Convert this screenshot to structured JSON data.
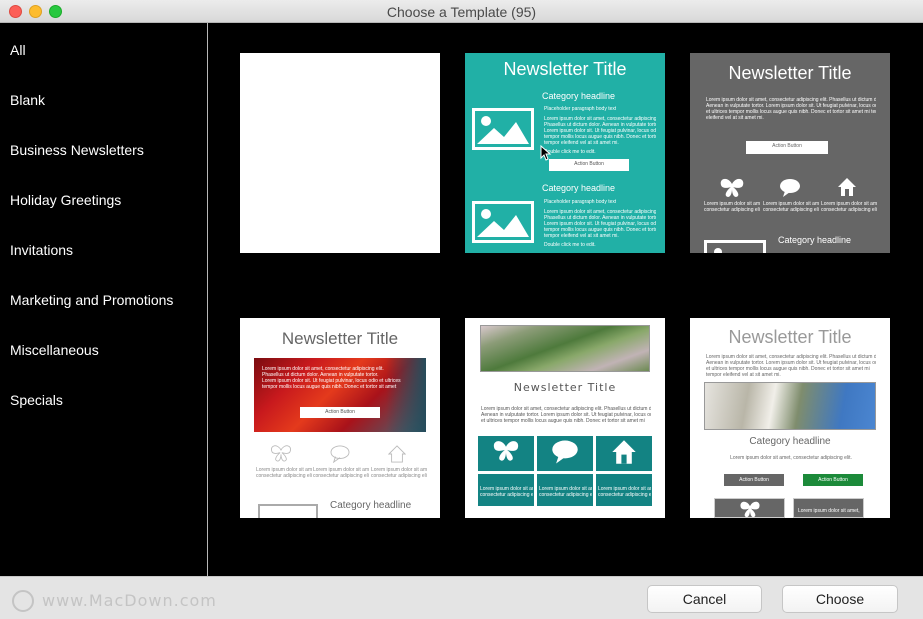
{
  "window": {
    "title": "Choose a Template (95)"
  },
  "sidebar": {
    "categories": [
      {
        "label": "All"
      },
      {
        "label": "Blank"
      },
      {
        "label": "Business Newsletters"
      },
      {
        "label": "Holiday Greetings"
      },
      {
        "label": "Invitations"
      },
      {
        "label": "Marketing and Promotions"
      },
      {
        "label": "Miscellaneous"
      },
      {
        "label": "Specials"
      }
    ]
  },
  "templates": {
    "t2": {
      "title": "Newsletter Title",
      "headline": "Category headline",
      "placeholder": "Placeholder paragraph body text",
      "lorem1": "Lorem ipsum dolor sit amet, consectetur adipiscing elit.",
      "lorem2": "Phasellus ut dictum dolor. Aenean in vulputate tortor.",
      "lorem3": "Lorem ipsum dolor sit. Ut feugiat pulvinar, locus odio et ultrices",
      "lorem4": "tempor mollis locus augue quis nibh. Donec et tortor sit amet mi",
      "lorem5": "tempor eleifend vel at sit amet mi.",
      "dbl": "Double click me to edit.",
      "action": "Action Button",
      "headline2": "Category headline",
      "placeholder2": "Placeholder paragraph body text",
      "dbl2": "Double click me to edit."
    },
    "t3": {
      "title": "Newsletter Title",
      "lorem1": "Lorem ipsum dolor sit amet, consectetur adipiscing elit. Phasellus ut dictum dolor.",
      "lorem2": "Aenean in vulputate tortor. Lorem ipsum dolor sit. Ut feugiat pulvinar, locus odio",
      "lorem3": "et ultrices tempor mollis locus augue quis nibh. Donec et tortor sit amet mi tempor",
      "lorem4": "eleifend vel at sit amet mi.",
      "action": "Action Button",
      "col_text1": "Lorem ipsum dolor sit amet,",
      "col_text2": "consectetur adipiscing elit.",
      "headline": "Category headline"
    },
    "t4": {
      "title": "Newsletter Title",
      "lorem1": "Lorem ipsum dolor sit amet, consectetur adipiscing elit.",
      "lorem2": "Phasellus ut dictum dolor. Aenean in vulputate tortor.",
      "lorem3": "Lorem ipsum dolor sit. Ut feugiat pulvinar, locus odio et ultrices",
      "lorem4": "tempor mollis locus augue quis nibh. Donec et tortor sit amet",
      "action": "Action Button",
      "col_text1": "Lorem ipsum dolor sit amet,",
      "col_text2": "consectetur adipiscing elit.",
      "headline": "Category headline"
    },
    "t5": {
      "title": "Newsletter Title",
      "lorem1": "Lorem ipsum dolor sit amet, consectetur adipiscing elit. Phasellus ut dictum dolor.",
      "lorem2": "Aenean in vulputate tortor. Lorem ipsum dolor sit. Ut feugiat pulvinar, locus odio",
      "lorem3": "et ultrices tempor mollis locus augue quis nibh. Donec et tortor sit amet mi",
      "col_text1": "Lorem ipsum dolor sit amet,",
      "col_text2": "consectetur adipiscing elit."
    },
    "t6": {
      "title": "Newsletter Title",
      "lorem1": "Lorem ipsum dolor sit amet, consectetur adipiscing elit. Phasellus ut dictum dolor.",
      "lorem2": "Aenean in vulputate tortor. Lorem ipsum dolor sit. Ut feugiat pulvinar, locus odio",
      "lorem3": "et ultrices tempor mollis locus augue quis nibh. Donec et tortor sit amet mi",
      "lorem4": "tempor eleifend vel at sit amet mi.",
      "headline": "Category headline",
      "small": "Lorem ipsum dolor sit amet, consectetur adipiscing elit.",
      "action1": "Action Button",
      "action2": "Action Button",
      "col_text1": "Lorem ipsum dolor sit amet,",
      "col_text2": "consectetur adipiscing elit."
    }
  },
  "footer": {
    "cancel_label": "Cancel",
    "choose_label": "Choose",
    "watermark": "www.MacDown.com"
  },
  "colors": {
    "teal": "#21b0a6",
    "gray_template": "#666666",
    "dark_teal": "#138383",
    "green_button": "#1c8a3a"
  }
}
